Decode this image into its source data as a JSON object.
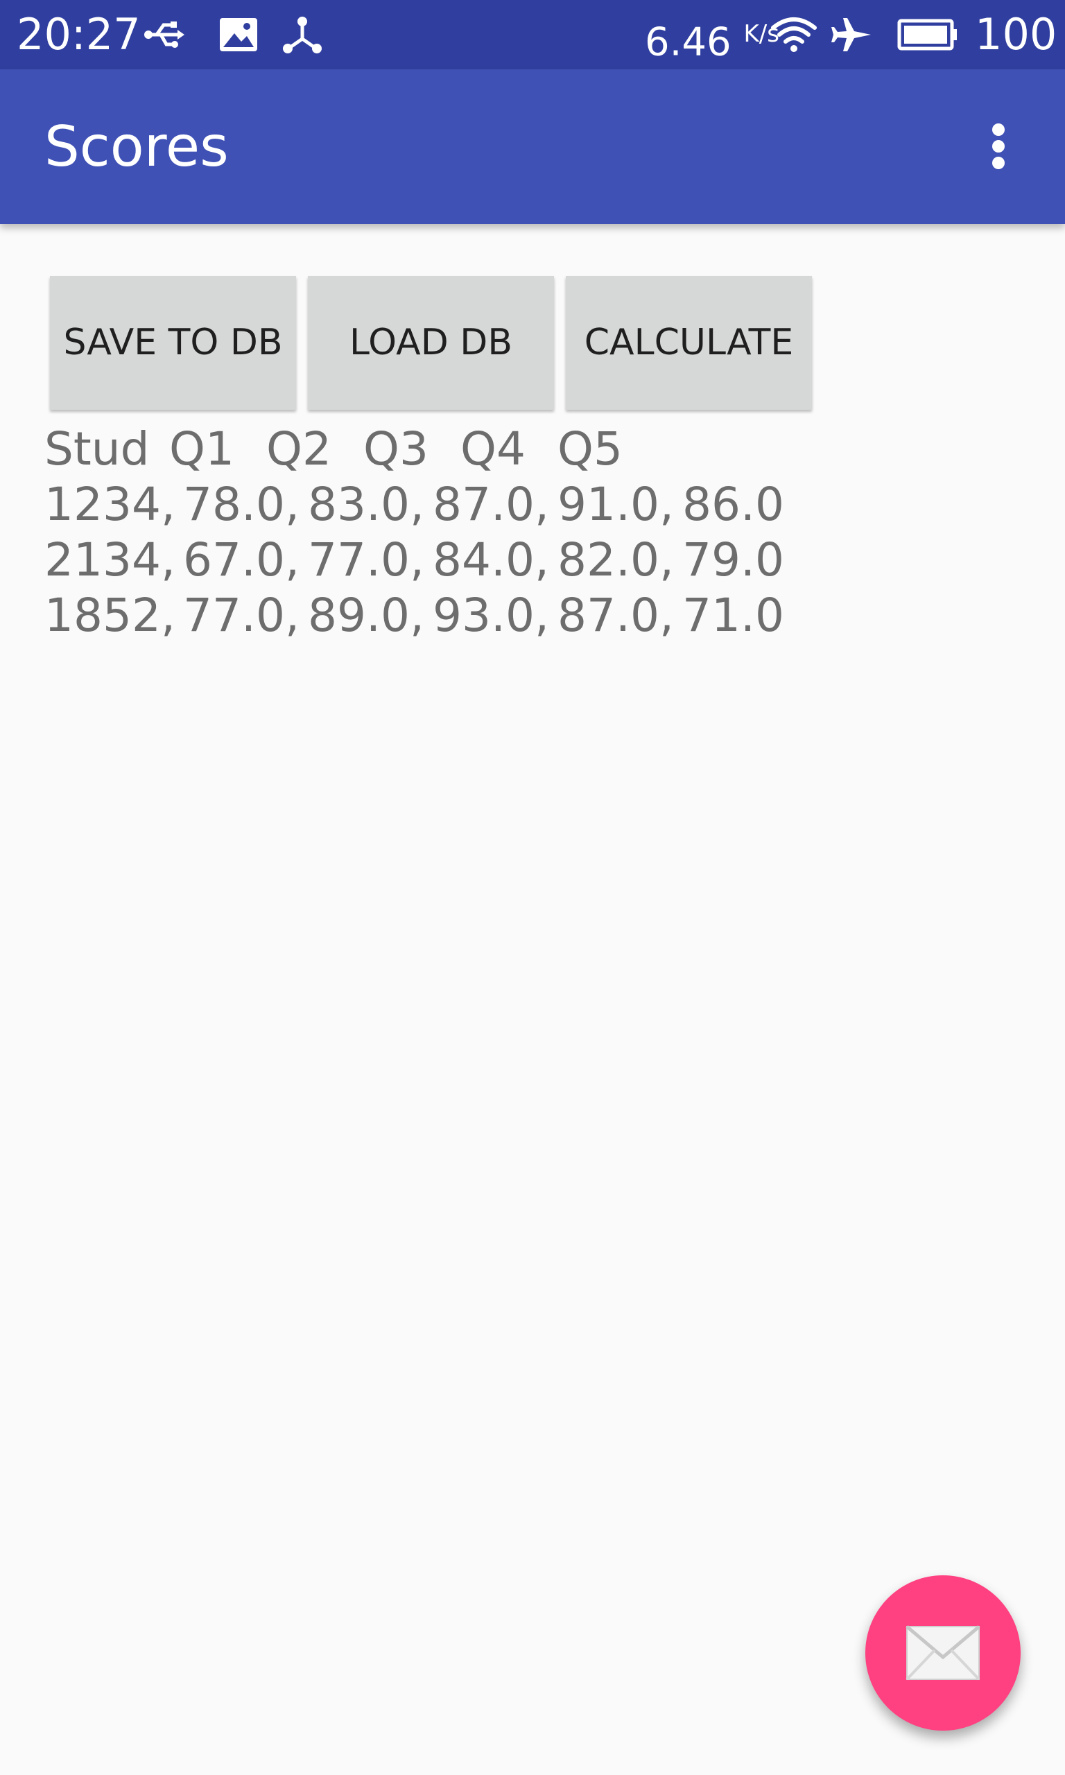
{
  "status_bar": {
    "time": "20:27",
    "network_speed": "6.46",
    "network_speed_unit": "K/s",
    "battery_percent": "100",
    "icons": [
      "usb-icon",
      "image-icon",
      "share-icon",
      "wifi-icon",
      "airplane-mode-icon",
      "battery-icon"
    ]
  },
  "app_bar": {
    "title": "Scores",
    "menu_icon": "overflow-menu-icon"
  },
  "buttons": {
    "save": "SAVE TO DB",
    "load": "LOAD DB",
    "calculate": "CALCULATE"
  },
  "scores": {
    "headers": [
      "Stud",
      "Q1",
      "Q2",
      "Q3",
      "Q4",
      "Q5"
    ],
    "rows": [
      [
        "1234,",
        "78.0,",
        "83.0,",
        "87.0,",
        "91.0,",
        "86.0"
      ],
      [
        "2134,",
        "67.0,",
        "77.0,",
        "84.0,",
        "82.0,",
        "79.0"
      ],
      [
        "1852,",
        "77.0,",
        "89.0,",
        "93.0,",
        "87.0,",
        "71.0"
      ]
    ]
  },
  "fab": {
    "icon": "email-icon"
  },
  "colors": {
    "status_bar": "#303f9f",
    "app_bar": "#3f51b5",
    "fab": "#ff4081",
    "button": "#d6d7d7"
  }
}
